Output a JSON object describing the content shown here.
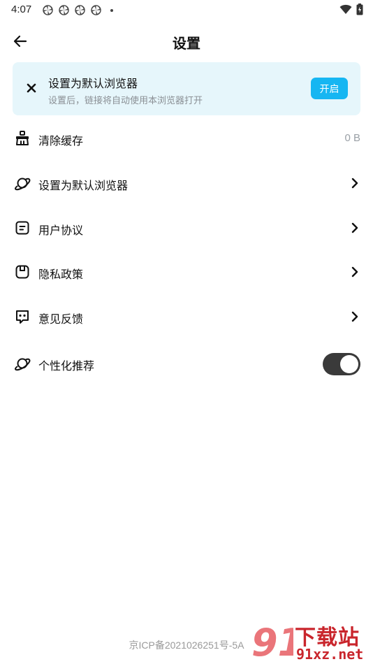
{
  "status_bar": {
    "time": "4:07",
    "notification_icons": [
      "pinwheel-icon",
      "pinwheel-icon",
      "pinwheel-icon",
      "pinwheel-icon"
    ],
    "right_icons": [
      "wifi-icon",
      "battery-icon"
    ]
  },
  "header": {
    "title": "设置",
    "back_icon": "arrow-left-icon"
  },
  "banner": {
    "title": "设置为默认浏览器",
    "subtitle": "设置后，链接将自动使用本浏览器打开",
    "button_label": "开启",
    "close_icon": "close-icon",
    "background": "#e6f6fb",
    "button_color": "#16b6f2"
  },
  "settings": [
    {
      "label": "清除缓存",
      "value": "0 B",
      "icon": "broom-icon"
    },
    {
      "label": "设置为默认浏览器",
      "icon": "planet-icon"
    },
    {
      "label": "用户协议",
      "icon": "document-icon"
    },
    {
      "label": "隐私政策",
      "icon": "shield-icon"
    },
    {
      "label": "意见反馈",
      "icon": "feedback-icon"
    },
    {
      "label": "个性化推荐",
      "icon": "planet-icon",
      "toggle_on": true
    }
  ],
  "footer": {
    "icp": "京ICP备2021026251号-5A"
  },
  "watermark": {
    "title": "下载站",
    "subtitle": "91xz.net",
    "logo_text": "91",
    "color": "#c9252c"
  }
}
